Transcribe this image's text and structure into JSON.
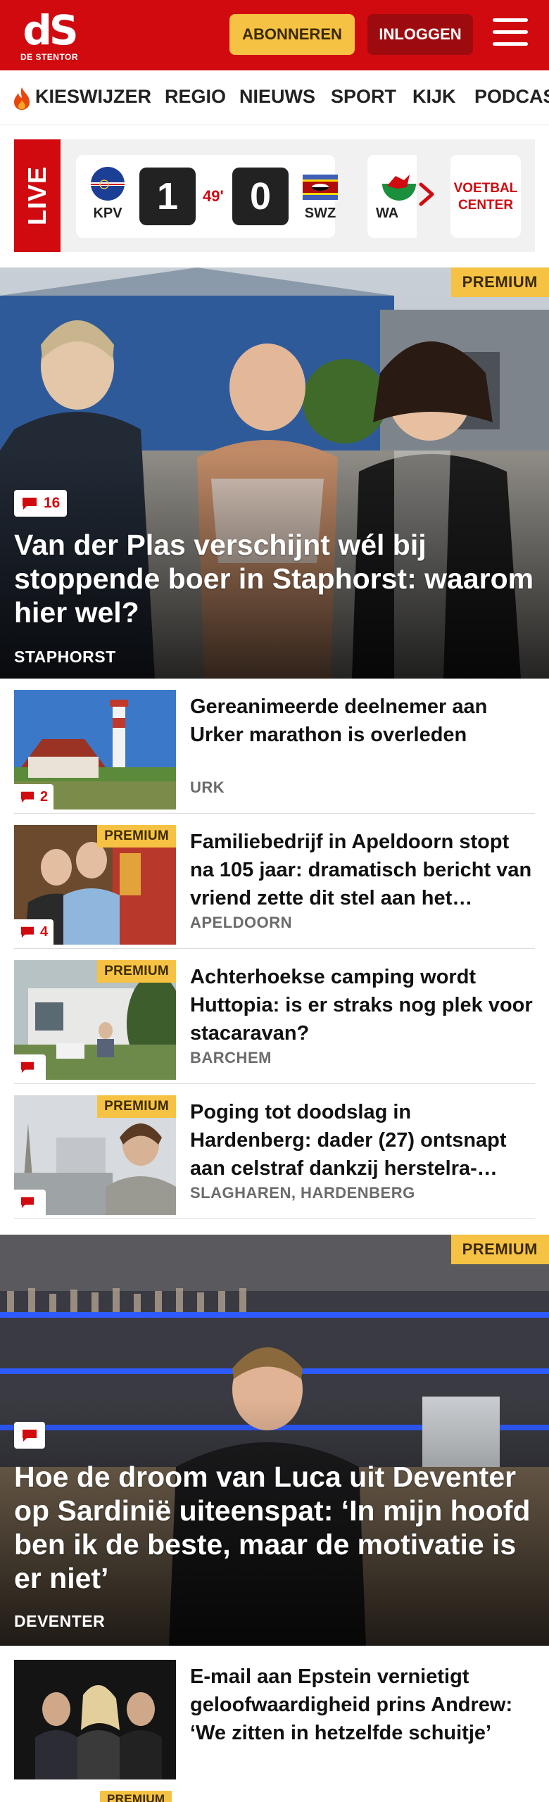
{
  "header": {
    "logo_mark": "dS",
    "logo_sub": "DE STENTOR",
    "subscribe_label": "ABONNEREN",
    "login_label": "INLOGGEN",
    "brand_color": "#d10a10"
  },
  "nav": {
    "items": [
      "KIESWIJZER",
      "REGIO",
      "NIEUWS",
      "SPORT",
      "KIJK",
      "PODCAS"
    ]
  },
  "live": {
    "label": "LIVE",
    "match": {
      "home_team": "KPV",
      "away_team": "SWZ",
      "home_score": "1",
      "away_score": "0",
      "minute": "49'"
    },
    "next_match_team": "WA",
    "football_center": "VOETBAL CENTER"
  },
  "hero1": {
    "premium_label": "PREMIUM",
    "comments": "16",
    "title": "Van der Plas verschijnt wél bij stoppende boer in Staphorst: waarom hier wel?",
    "location": "STAPHORST"
  },
  "articles": [
    {
      "title": "Gereanimeerde deelnemer aan Urker marathon is overleden",
      "location": "URK",
      "comments": "2",
      "premium": ""
    },
    {
      "title": "Familiebedrijf in Apeldoorn stopt na 105 jaar: dramatisch bericht van vriend zette dit stel aan het…",
      "location": "APELDOORN",
      "comments": "4",
      "premium": "PREMIUM"
    },
    {
      "title": "Achterhoekse camping wordt Huttopia: is er straks nog plek voor stacaravan?",
      "location": "BARCHEM",
      "comments": "",
      "premium": "PREMIUM"
    },
    {
      "title": "Poging tot doodslag in Hardenberg: dader (27) ontsnapt aan celstraf dankzij herstelra-…",
      "location": "SLAGHAREN, HARDENBERG",
      "comments": "",
      "premium": "PREMIUM"
    }
  ],
  "hero2": {
    "premium_label": "PREMIUM",
    "title": "Hoe de droom van Luca uit Deventer op Sardinië uiteenspat: ‘In mijn hoofd ben ik de beste, maar de motivatie is er niet’",
    "location": "DEVENTER"
  },
  "article_last": {
    "title": "E-mail aan Epstein vernietigt geloofwaardigheid prins Andrew: ‘We zitten in hetzelfde schuitje’",
    "next_premium": "PREMIUM"
  }
}
